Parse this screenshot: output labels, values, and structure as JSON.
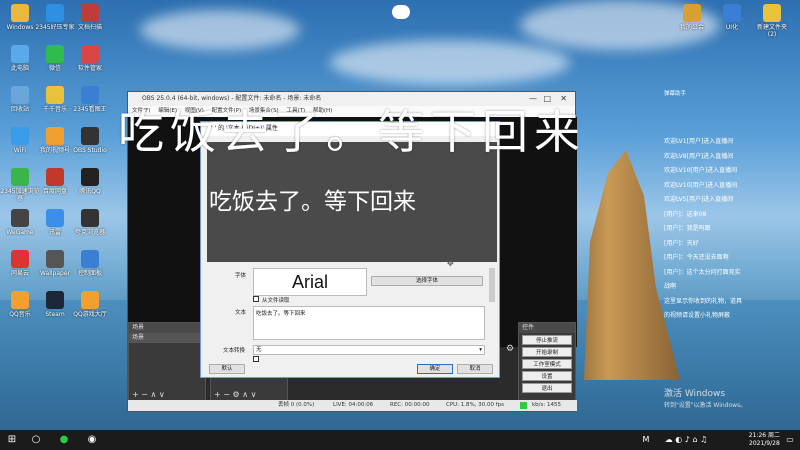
{
  "desktop": {
    "icons_left": [
      {
        "label": "Windows",
        "color": "#e8b93a"
      },
      {
        "label": "2345好压专家",
        "color": "#2f8fe0"
      },
      {
        "label": "文档扫描",
        "color": "#c03b3b"
      },
      {
        "label": "此电脑",
        "color": "#5aa9e8"
      },
      {
        "label": "微信",
        "color": "#2ebd4a"
      },
      {
        "label": "软件管家",
        "color": "#d44"
      },
      {
        "label": "回收站",
        "color": "#6aa6d8"
      },
      {
        "label": "千千音乐",
        "color": "#e8c23a"
      },
      {
        "label": "2345看图王",
        "color": "#3a7fd4"
      },
      {
        "label": "WiFi",
        "color": "#3a9be8"
      },
      {
        "label": "我的视频号",
        "color": "#f0a030"
      },
      {
        "label": "OBS Studio",
        "color": "#333"
      },
      {
        "label": "2345加速浏览器",
        "color": "#39b54a"
      },
      {
        "label": "百度网盘",
        "color": "#c0392b"
      },
      {
        "label": "腾讯QQ",
        "color": "#222"
      },
      {
        "label": "WeGame",
        "color": "#444"
      },
      {
        "label": "迅雷",
        "color": "#3a8fe8"
      },
      {
        "label": "夸克浏览器",
        "color": "#333"
      },
      {
        "label": "网易云",
        "color": "#d33"
      },
      {
        "label": "Wallpaper",
        "color": "#555"
      },
      {
        "label": "控制面板",
        "color": "#3a7fd4"
      },
      {
        "label": "QQ音乐",
        "color": "#f0a030"
      },
      {
        "label": "Steam",
        "color": "#1b2838"
      },
      {
        "label": "QQ游戏大厅",
        "color": "#f0a030"
      }
    ],
    "icons_right": [
      {
        "label": "我的公会",
        "color": "#d8a030"
      },
      {
        "label": "UI化",
        "color": "#3a7fd4"
      },
      {
        "label": "新建文件夹 (2)",
        "color": "#e8c23a"
      }
    ]
  },
  "overlay_text": "吃饭去了。等下回来",
  "obs": {
    "title": "OBS 25.0.4 (64-bit, windows) - 配置文件: 未命名 - 场景: 未命名",
    "menu": [
      "文件(F)",
      "编辑(E)",
      "视图(V)",
      "配置文件(P)",
      "场景集合(S)",
      "工具(T)",
      "帮助(H)"
    ],
    "scenes_header": "场景",
    "scenes_item": "场景",
    "controls_header": "控件",
    "controls": [
      "停止推流",
      "开始录制",
      "工作室模式",
      "设置",
      "退出"
    ],
    "status": {
      "dropped": "丢帧 0 (0.0%)",
      "live": "LIVE: 04:00:06",
      "rec": "REC: 00:00:00",
      "cpu": "CPU: 1.8%, 30.00 fps",
      "kbps": "kb/s: 1455"
    }
  },
  "dialog": {
    "title": "'  ' 的 '文本 (GDI+)' 属性",
    "preview_text": "吃饭去了。等下回来",
    "font_label": "字体",
    "font_value": "Arial",
    "select_font_button": "选择字体",
    "from_file_label": "从文件读取",
    "text_label": "文本",
    "text_value": "吃饭去了。等下回来",
    "transform_label": "文本转换",
    "transform_value": "无",
    "defaults_button": "默认",
    "ok_button": "确定",
    "cancel_button": "取消"
  },
  "chat": {
    "header": "弹幕助手",
    "lines": [
      "欢迎LV1[用户]进入直播间",
      "欢迎LV8[用户]进入直播间",
      "欢迎LV10[用户]进入直播间",
      "欢迎LV10[用户]进入直播间",
      "欢迎LV5[用户]进入直播间",
      "[用户]：这来08",
      "[用户]：我是吗跟",
      "[用户]：天好",
      "[用户]：今天还没去面啊",
      "[用户]：这个太分问打面竞实",
      "战啊",
      "这里显示你收到的礼物，道具",
      "的视频请设置小礼物屏蔽"
    ]
  },
  "activate": {
    "line1": "激活 Windows",
    "line2": "转到\"设置\"以激活 Windows。"
  },
  "taskbar": {
    "time": "21:26 周二",
    "date": "2021/9/28",
    "ime": "M"
  }
}
